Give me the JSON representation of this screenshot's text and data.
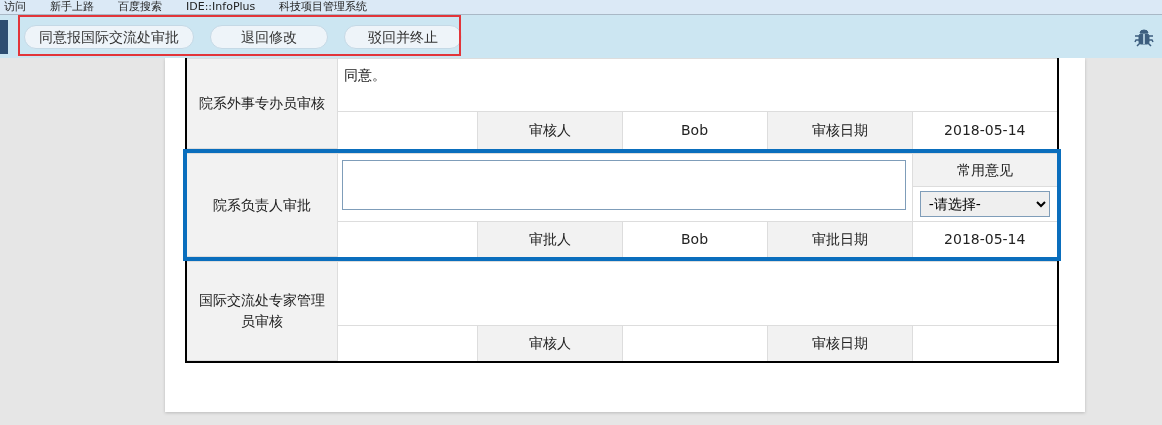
{
  "bookmarks": [
    "访问",
    "新手上路",
    "百度搜索",
    "IDE::InfoPlus",
    "科技项目管理系统"
  ],
  "toolbar": {
    "buttons": [
      "同意报国际交流处审批",
      "退回修改",
      "驳回并终止"
    ]
  },
  "sections": [
    {
      "label": "院系外事专办员审核",
      "kind": "done",
      "active": false,
      "opinion": "同意。",
      "signer_label": "审核人",
      "signer": "Bob",
      "date_label": "审核日期",
      "date": "2018-05-14"
    },
    {
      "label": "院系负责人审批",
      "kind": "editing",
      "active": true,
      "common_label": "常用意见",
      "select": {
        "value": "-请选择-"
      },
      "signer_label": "审批人",
      "signer": "Bob",
      "date_label": "审批日期",
      "date": "2018-05-14"
    },
    {
      "label": "国际交流处专家管理员审核",
      "kind": "pending",
      "active": false,
      "signer_label": "审核人",
      "date_label": "审核日期"
    }
  ]
}
